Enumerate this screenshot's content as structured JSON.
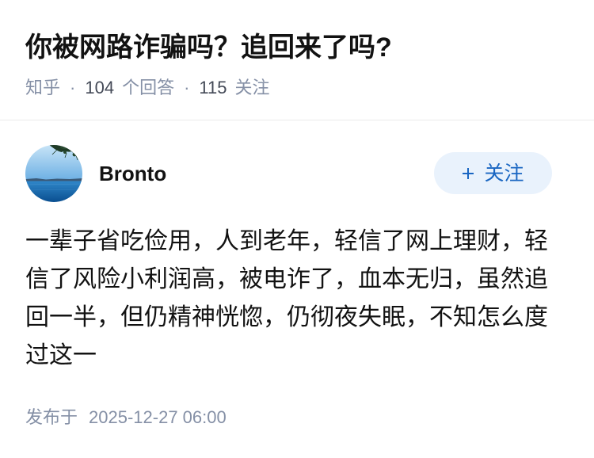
{
  "question": {
    "title": "你被网路诈骗吗？追回来了吗?",
    "source": "知乎",
    "separator": "·",
    "answer_count": "104",
    "answer_label": "个回答",
    "follow_count": "115",
    "follow_label": "关注"
  },
  "answer": {
    "author": {
      "name": "Bronto",
      "avatar_icon": "avatar-seascape"
    },
    "follow_button": {
      "icon": "plus-icon",
      "label": "关注"
    },
    "content": "一辈子省吃俭用，人到老年，轻信了网上理财，轻信了风险小利润高，被电诈了，血本无归，虽然追回一半，但仍精神恍惚，仍彻夜失眠，不知怎么度过这一",
    "published_label": "发布于",
    "published_time": "2025-12-27 06:00"
  },
  "colors": {
    "text": "#121212",
    "muted": "#8590a6",
    "accent": "#1966c2",
    "button_bg": "#e9f2fc"
  }
}
